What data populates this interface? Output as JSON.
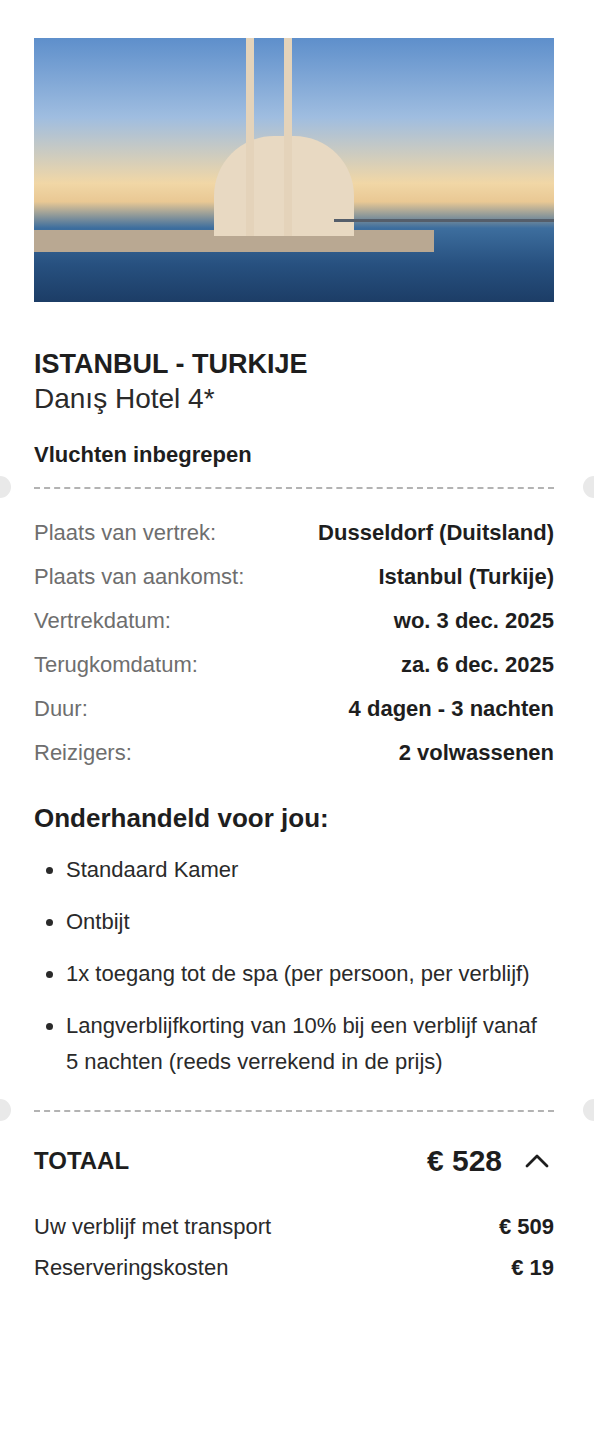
{
  "destination": "ISTANBUL - TURKIJE",
  "hotel": "Danış Hotel 4*",
  "flights": "Vluchten inbegrepen",
  "details": [
    {
      "label": "Plaats van vertrek:",
      "value": "Dusseldorf (Duitsland)"
    },
    {
      "label": "Plaats van aankomst:",
      "value": "Istanbul (Turkije)"
    },
    {
      "label": "Vertrekdatum:",
      "value": "wo. 3 dec. 2025"
    },
    {
      "label": "Terugkomdatum:",
      "value": "za. 6 dec. 2025"
    },
    {
      "label": "Duur:",
      "value": "4 dagen - 3 nachten"
    },
    {
      "label": "Reizigers:",
      "value": "2 volwassenen"
    }
  ],
  "negotiated": {
    "title": "Onderhandeld voor jou:",
    "items": [
      "Standaard Kamer",
      "Ontbijt",
      "1x toegang tot de spa (per persoon, per verblijf)",
      "Langverblijfkorting van 10% bij een verblijf vanaf 5 nachten (reeds verrekend in de prijs)"
    ]
  },
  "total": {
    "label": "TOTAAL",
    "amount": "€ 528",
    "expanded": true,
    "lines": [
      {
        "label": "Uw verblijf met transport",
        "amount": "€ 509"
      },
      {
        "label": "Reserveringskosten",
        "amount": "€ 19"
      }
    ]
  }
}
